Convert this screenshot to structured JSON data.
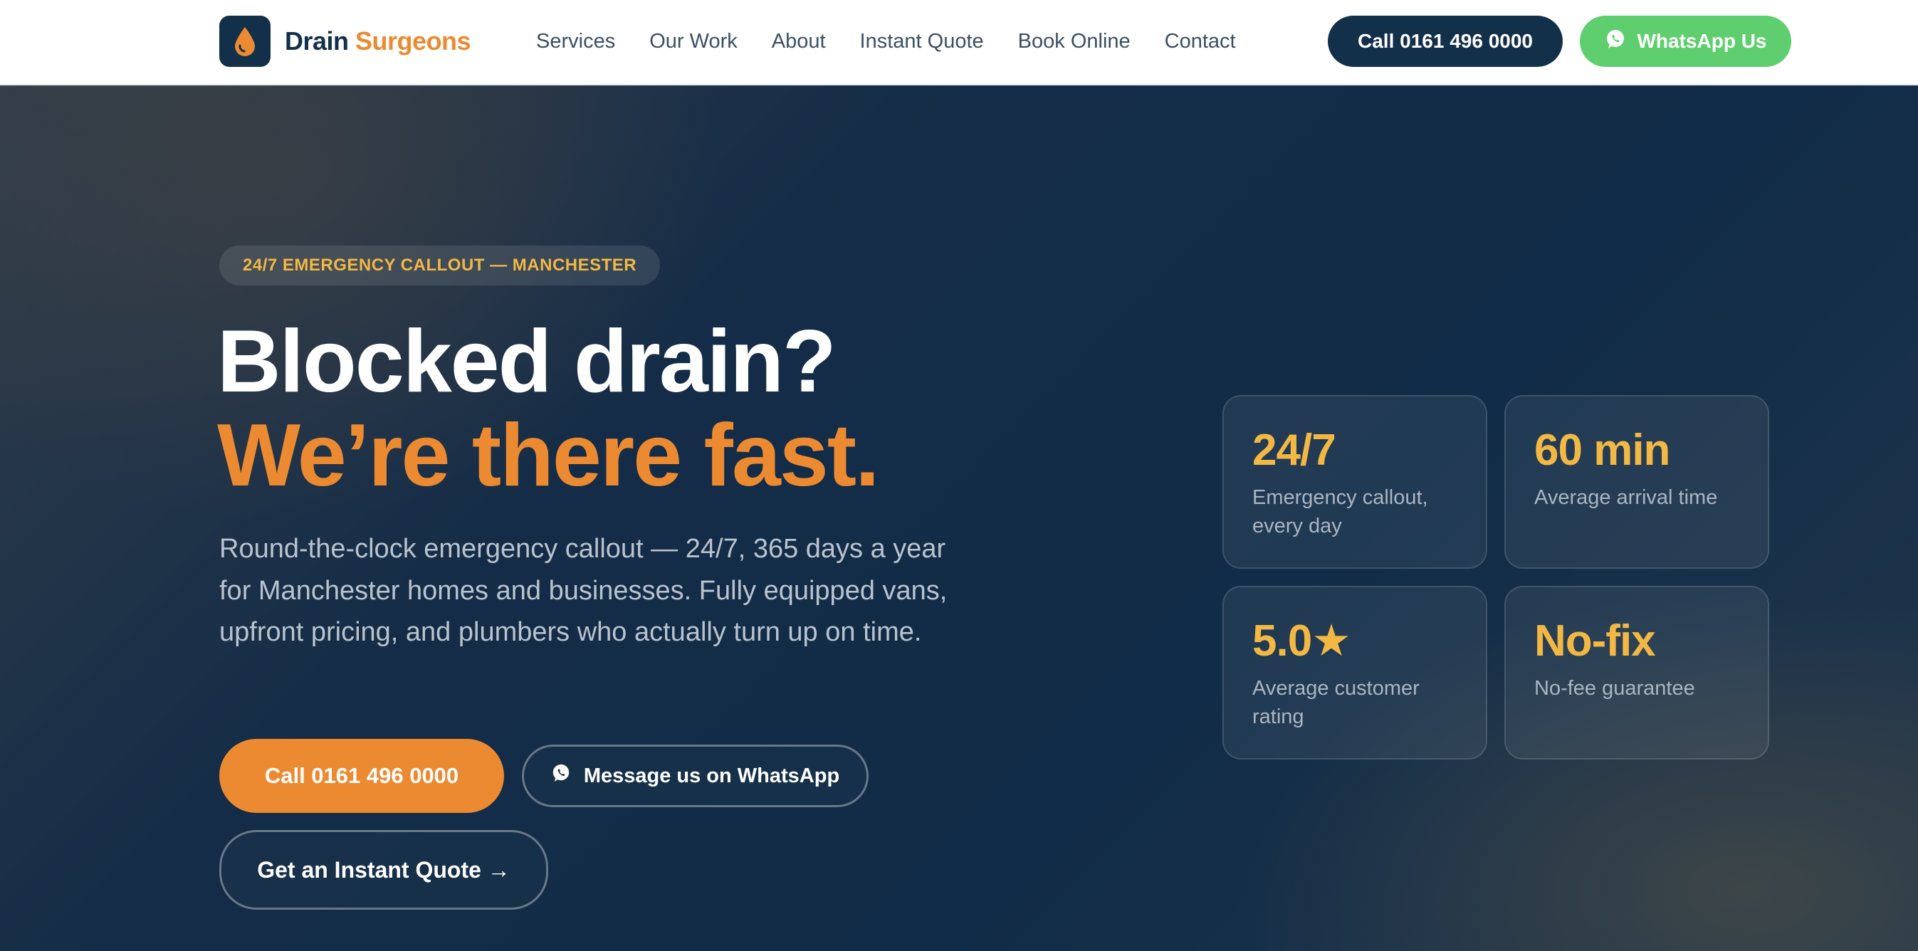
{
  "brand": {
    "name_part1": "Drain",
    "name_part2": "Surgeons",
    "icon": "water-drop-icon",
    "colors": {
      "navy": "#13304a",
      "orange": "#ec8a32",
      "gold": "#f2b843",
      "whatsapp_green": "#5fce6e"
    }
  },
  "nav": {
    "items": [
      {
        "label": "Services"
      },
      {
        "label": "Our Work"
      },
      {
        "label": "About"
      },
      {
        "label": "Instant Quote"
      },
      {
        "label": "Book Online"
      },
      {
        "label": "Contact"
      }
    ]
  },
  "header_actions": {
    "call_label": "Call 0161 496 0000",
    "whatsapp_label": "WhatsApp Us",
    "whatsapp_icon": "whatsapp-icon"
  },
  "hero": {
    "badge": "24/7 EMERGENCY CALLOUT — MANCHESTER",
    "headline_line1": "Blocked drain?",
    "headline_line2": "We’re there fast.",
    "description": "Round-the-clock emergency callout — 24/7, 365 days a year for Manchester homes and businesses. Fully equipped vans, upfront pricing, and plumbers who actually turn up on time.",
    "cta_call_label": "Call 0161 496 0000",
    "cta_whatsapp_label": "Message us on WhatsApp",
    "cta_quote_label": "Get an Instant Quote →"
  },
  "stats": [
    {
      "value": "24/7",
      "label": "Emergency callout, every day"
    },
    {
      "value": "60 min",
      "label": "Average arrival time"
    },
    {
      "value": "5.0★",
      "label": "Average customer rating"
    },
    {
      "value": "No-fix",
      "label": "No-fee guarantee"
    }
  ]
}
